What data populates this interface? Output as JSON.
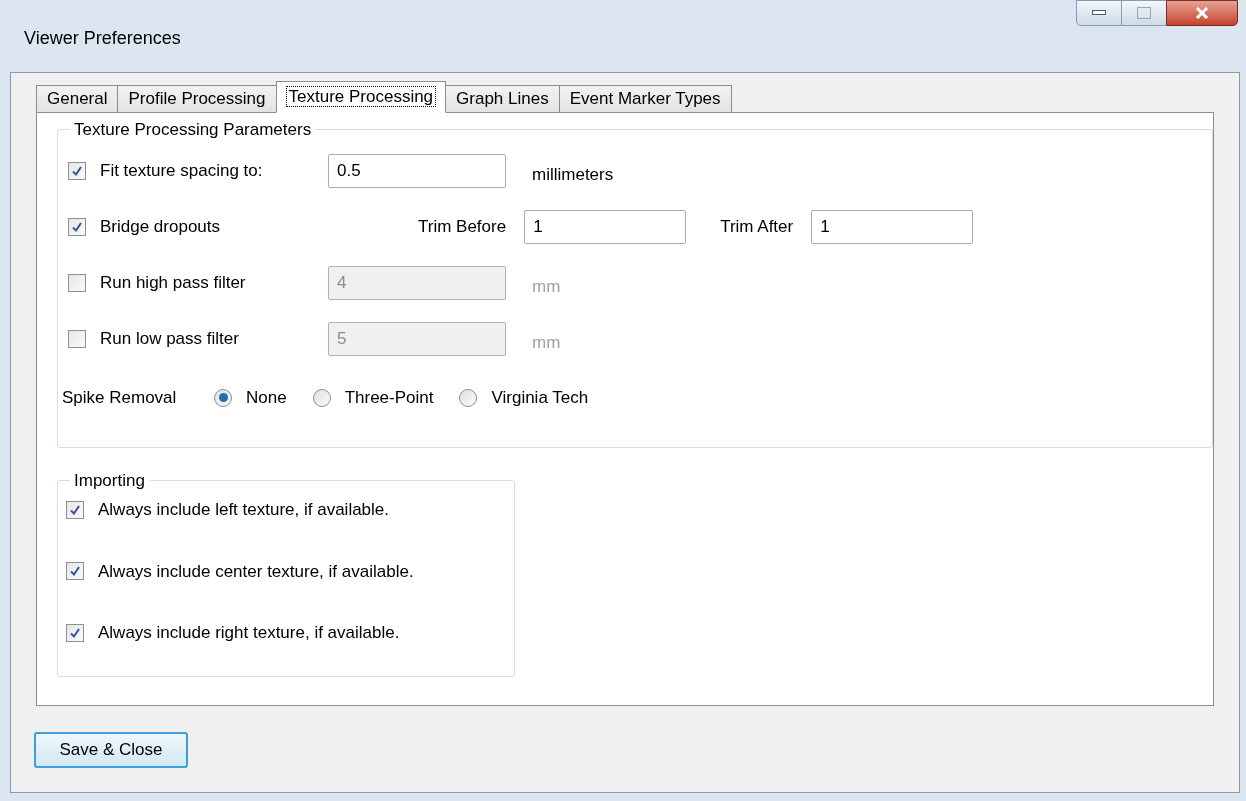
{
  "window": {
    "title": "Viewer Preferences"
  },
  "tabs": [
    {
      "label": "General",
      "selected": false
    },
    {
      "label": "Profile Processing",
      "selected": false
    },
    {
      "label": "Texture Processing",
      "selected": true
    },
    {
      "label": "Graph Lines",
      "selected": false
    },
    {
      "label": "Event Marker Types",
      "selected": false
    }
  ],
  "parameters": {
    "title": "Texture Processing Parameters",
    "rows": [
      {
        "kind": "field",
        "label": "Fit texture spacing to:",
        "checked": true,
        "value": "0.5",
        "unit": "millimeters",
        "disabled": false
      },
      {
        "kind": "trim",
        "label": "Bridge dropouts",
        "checked": true,
        "fields": [
          {
            "label": "Trim Before",
            "value": "1"
          },
          {
            "label": "Trim After",
            "value": "1"
          }
        ]
      },
      {
        "kind": "field",
        "label": "Run high pass filter",
        "checked": false,
        "value": "4",
        "unit": "mm",
        "disabled": true
      },
      {
        "kind": "field",
        "label": "Run low pass filter",
        "checked": false,
        "value": "5",
        "unit": "mm",
        "disabled": true
      }
    ],
    "spike_removal": {
      "label": "Spike Removal",
      "options": [
        {
          "label": "None",
          "selected": true
        },
        {
          "label": "Three-Point",
          "selected": false
        },
        {
          "label": "Virginia Tech",
          "selected": false
        }
      ]
    }
  },
  "importing": {
    "title": "Importing",
    "options": [
      {
        "label": "Always include left texture, if available.",
        "checked": true
      },
      {
        "label": "Always include center texture, if available.",
        "checked": true
      },
      {
        "label": "Always include right texture, if available.",
        "checked": true
      }
    ]
  },
  "buttons": [
    {
      "label": "Save & Close"
    }
  ]
}
